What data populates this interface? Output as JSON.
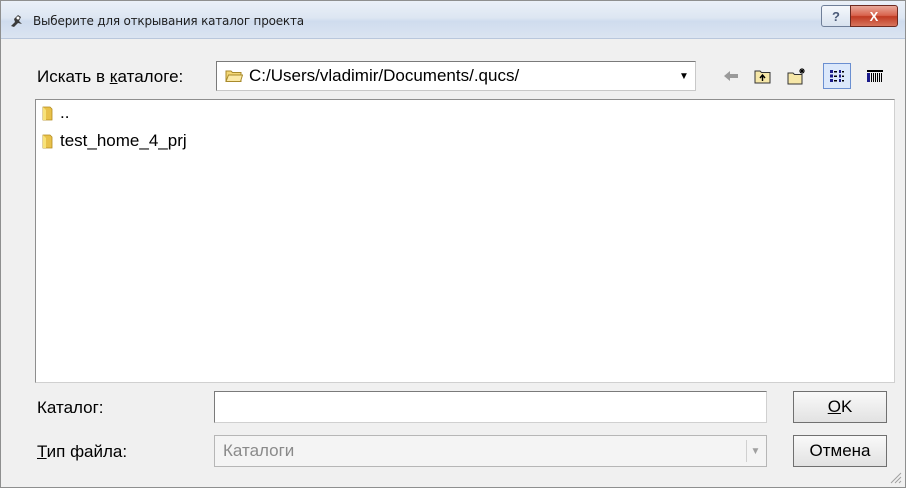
{
  "window": {
    "title": "Выберите для открывания каталог проекта",
    "help_label": "?",
    "close_label": "X"
  },
  "lookin": {
    "label_pre": "Искать в ",
    "label_accel": "к",
    "label_post": "аталоге:",
    "path": "C:/Users/vladimir/Documents/.qucs/"
  },
  "toolbar": {
    "icons": [
      "back-icon",
      "parent-folder-icon",
      "new-folder-icon",
      "list-view-icon",
      "detail-view-icon"
    ]
  },
  "files": [
    {
      "name": "..",
      "icon": "folder-icon"
    },
    {
      "name": "test_home_4_prj",
      "icon": "folder-icon"
    }
  ],
  "directory": {
    "label": "Каталог:",
    "value": ""
  },
  "filetype": {
    "label_accel": "Т",
    "label_post": "ип файла:",
    "value": "Каталоги"
  },
  "buttons": {
    "ok_accel": "O",
    "ok_post": "K",
    "cancel": "Отмена"
  }
}
